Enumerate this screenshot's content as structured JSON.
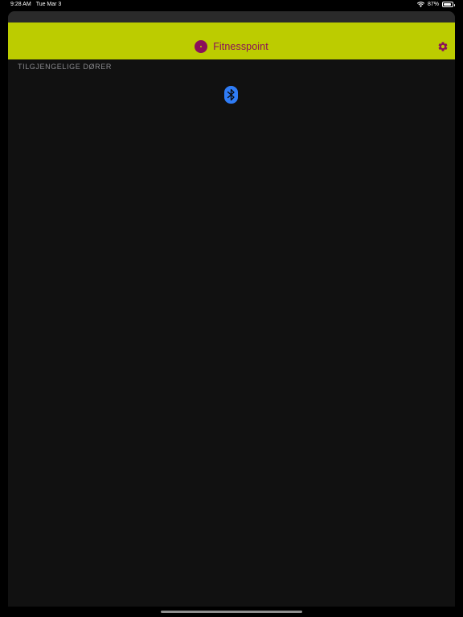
{
  "status_bar": {
    "time": "9:28 AM",
    "date": "Tue Mar 3",
    "battery_percent": "87%",
    "battery_level": 0.87,
    "wifi_icon": "wifi-icon",
    "battery_icon": "battery-icon"
  },
  "header": {
    "title": "Fitnesspoint",
    "logo_icon": "logo-icon",
    "settings_icon": "gear-icon",
    "background_color": "#bccc00",
    "accent_color": "#8b0f5a"
  },
  "main": {
    "section_header": "TILGJENGELIGE DØRER",
    "status_icon": "bluetooth-icon",
    "status_icon_color": "#2f7cf6"
  }
}
